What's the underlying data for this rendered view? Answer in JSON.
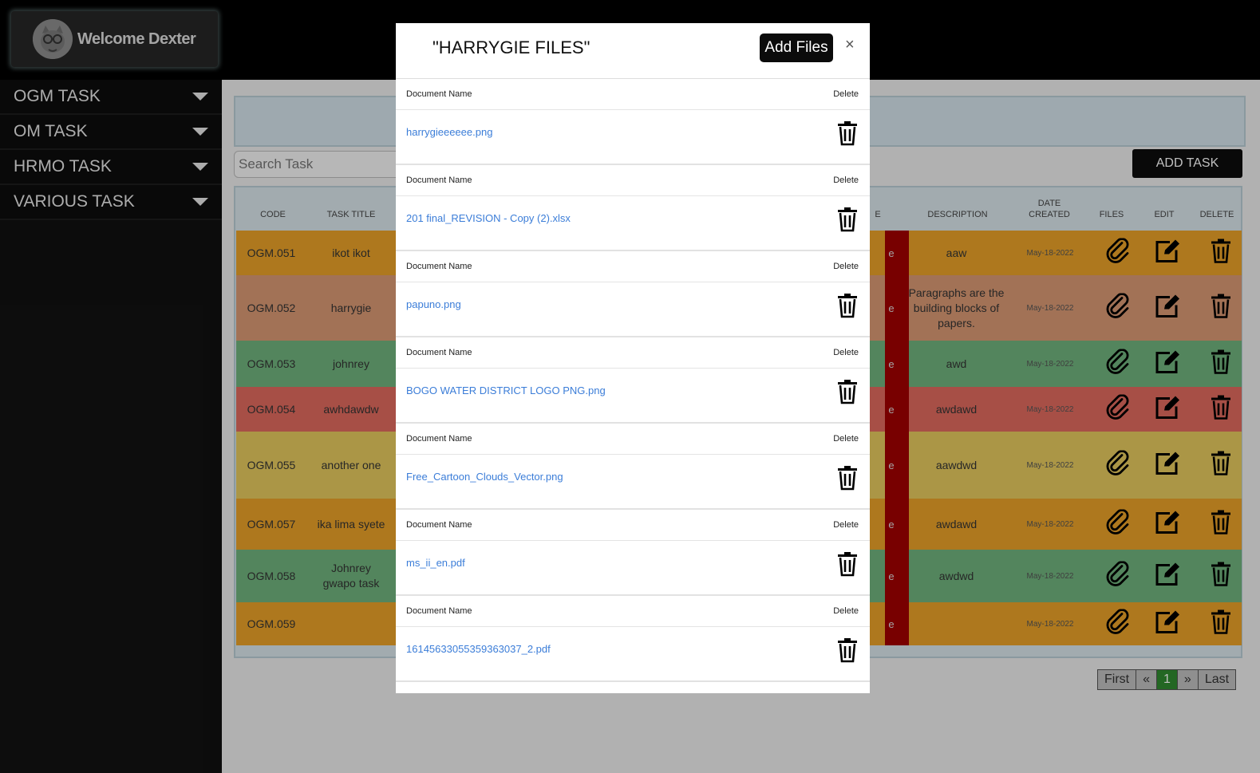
{
  "header": {
    "welcome": "Welcome Dexter"
  },
  "sidebar": {
    "items": [
      {
        "label": "OGM TASK"
      },
      {
        "label": "OM TASK"
      },
      {
        "label": "HRMO TASK"
      },
      {
        "label": "VARIOUS TASK"
      }
    ]
  },
  "main": {
    "search_placeholder": "Search Task",
    "add_task": "ADD TASK",
    "columns": {
      "code": "CODE",
      "title": "TASK TITLE",
      "partial": "E",
      "description": "DESCRIPTION",
      "date_line1": "DATE",
      "date_line2": "CREATED",
      "files": "FILES",
      "edit": "EDIT",
      "delete": "DELETE"
    },
    "rows": [
      {
        "code": "OGM.051",
        "title": "ikot ikot",
        "partial": "e",
        "description": "aaw",
        "date": "May-18-2022",
        "color": "#e9a128"
      },
      {
        "code": "OGM.052",
        "title": "harrygie",
        "partial": "e",
        "description": "Paragraphs are the building blocks of papers.",
        "date": "May-18-2022",
        "color": "#d99873"
      },
      {
        "code": "OGM.053",
        "title": "johnrey",
        "partial": "e",
        "description": "awd",
        "date": "May-18-2022",
        "color": "#6fb27c"
      },
      {
        "code": "OGM.054",
        "title": "awhdawdw",
        "partial": "e",
        "description": "awdawd",
        "date": "May-18-2022",
        "color": "#df6a5e"
      },
      {
        "code": "OGM.055",
        "title": "another one",
        "partial": "e",
        "description": "aawdwd",
        "date": "May-18-2022",
        "color": "#e4c85e"
      },
      {
        "code": "OGM.057",
        "title": "ika lima syete",
        "partial": "e",
        "description": "awdawd",
        "date": "May-18-2022",
        "color": "#e9a128"
      },
      {
        "code": "OGM.058",
        "title": "Johnrey gwapo task",
        "partial": "e",
        "description": "awdwd",
        "date": "May-18-2022",
        "color": "#6fb27c"
      },
      {
        "code": "OGM.059",
        "title": "",
        "partial": "e",
        "description": "",
        "date": "May-18-2022",
        "color": "#e9a128"
      }
    ],
    "pagination": {
      "first": "First",
      "prev": "«",
      "current": "1",
      "next": "»",
      "last": "Last"
    }
  },
  "modal": {
    "title": "\"HARRYGIE FILES\"",
    "add_files": "Add Files",
    "close": "×",
    "col_doc": "Document Name",
    "col_delete": "Delete",
    "files": [
      {
        "name": "harrygieeeeee.png"
      },
      {
        "name": "201 final_REVISION - Copy (2).xlsx"
      },
      {
        "name": "papuno.png"
      },
      {
        "name": "BOGO WATER DISTRICT LOGO PNG.png"
      },
      {
        "name": "Free_Cartoon_Clouds_Vector.png"
      },
      {
        "name": "ms_ii_en.pdf"
      },
      {
        "name": "16145633055359363037_2.pdf"
      },
      {
        "name": ""
      }
    ]
  },
  "colors": {
    "accent_red": "#a10000",
    "link": "#3b7dd8",
    "active_page": "#2f8a2f"
  }
}
